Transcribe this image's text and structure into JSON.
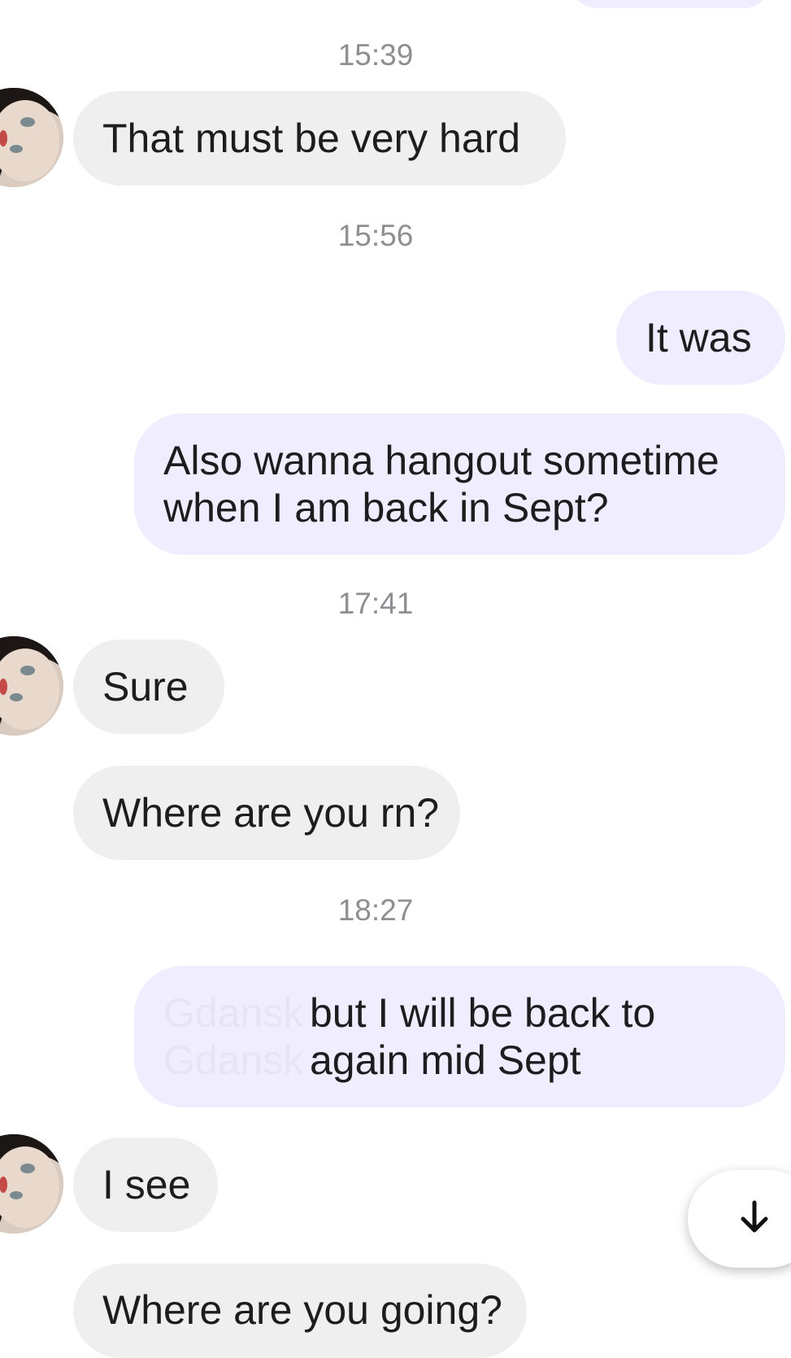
{
  "conversation": {
    "messages": [
      {
        "type": "time",
        "text": "15:39"
      },
      {
        "type": "incoming",
        "text": "That must be very hard"
      },
      {
        "type": "time",
        "text": "15:56"
      },
      {
        "type": "outgoing",
        "text": "It was"
      },
      {
        "type": "outgoing",
        "text": "Also wanna hangout sometime when I am back in Sept?"
      },
      {
        "type": "time",
        "text": "17:41"
      },
      {
        "type": "incoming",
        "text": "Sure"
      },
      {
        "type": "incoming",
        "text": "Where are you rn?"
      },
      {
        "type": "time",
        "text": "18:27"
      },
      {
        "type": "outgoing",
        "text": "but I will be back to again mid Sept",
        "obscured_text": "Gdansk Gdansk"
      },
      {
        "type": "incoming",
        "text": "I see"
      },
      {
        "type": "incoming",
        "text": "Where are you going?"
      }
    ]
  },
  "colors": {
    "incoming_bubble": "#efefef",
    "outgoing_bubble": "#efedff",
    "timestamp": "#8e8e93"
  },
  "scroll_button": {
    "icon": "arrow-down-icon"
  }
}
